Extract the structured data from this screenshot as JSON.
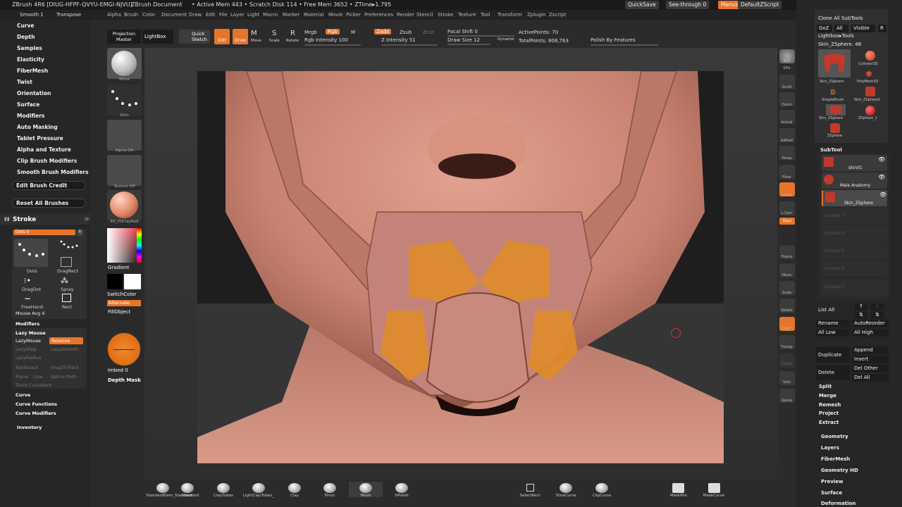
{
  "title_bar": {
    "app": "ZBrush 4R6 [DIUG-HFPF-QVYU-EMGI-NJVU]",
    "document": "ZBrush Document",
    "stats": "• Active Mem 443 • Scratch Disk 114 • Free Mem 3652 • ZTime▸1.795",
    "quicksave": "QuickSave",
    "see_through": "See-through 0",
    "menus": "Menus",
    "default_zscript": "DefaultZScript"
  },
  "top_left_tabs": [
    "Smooth 1",
    "Transpose"
  ],
  "menu_items": [
    "Alpha",
    "Brush",
    "Color",
    "Document",
    "Draw",
    "Edit",
    "File",
    "Layer",
    "Light",
    "Macro",
    "Marker",
    "Material",
    "Movie",
    "Picker",
    "Preferences",
    "Render",
    "Stencil",
    "Stroke",
    "Texture",
    "Tool",
    "Transform",
    "Zplugin",
    "Zscript"
  ],
  "left_palette": {
    "brush_sections": [
      "Curve",
      "Depth",
      "Samples",
      "Elasticity",
      "FiberMesh",
      "Twist",
      "Orientation",
      "Surface",
      "Modifiers",
      "Auto Masking",
      "Tablet Pressure",
      "Alpha and Texture",
      "Clip Brush Modifiers",
      "Smooth Brush Modifiers"
    ],
    "edit_brush_credit": "Edit Brush Credit",
    "reset_all_brushes": "Reset All Brushes",
    "stroke_title": "Stroke",
    "stroke_current": "Dots 0",
    "stroke_types": [
      "Dots",
      "DragRect",
      "DragDot",
      "Spray",
      "FreeHand",
      "Rect"
    ],
    "mouse_avg": "Mouse Avg 4",
    "modifiers": "Modifiers",
    "lazy_mouse": "Lazy Mouse",
    "lazymouse_label": "LazyMouse",
    "relative": "Relative",
    "disabled_options": [
      "LazyStep",
      "LazySmooth",
      "LazyRadius",
      "Backtrack",
      "SnapToTrack",
      "Plane",
      "Line",
      "Spline Path",
      "Track Curvature"
    ],
    "curve": "Curve",
    "curve_functions": "Curve Functions",
    "curve_modifiers": "Curve Modifiers",
    "inventory": "Inventory"
  },
  "tool_shelf": {
    "projection_master": "Projection Master",
    "lightbox": "LightBox",
    "quick_sketch": "Quick Sketch",
    "thumbs": [
      "Move",
      "Dots",
      "Alpha Off",
      "Texture Off",
      "RS_OilClayRed"
    ],
    "gradient": "Gradient",
    "switch_color": "SwitchColor",
    "alternate": "Alternate",
    "fill_object": "FillObject",
    "imbed": "Imbed 0",
    "depth_mask": "Depth Mask"
  },
  "toolbar": {
    "edit": "Edit",
    "draw": "Draw",
    "move": "Move",
    "scale": "Scale",
    "rotate": "Rotate",
    "mrgb": "Mrgb",
    "rgb": "Rgb",
    "m": "M",
    "rgb_intensity": "Rgb Intensity 100",
    "zadd": "Zadd",
    "zsub": "Zsub",
    "zcut": "Zcut",
    "z_intensity": "Z Intensity 51",
    "focal_shift": "Focal Shift 0",
    "draw_size": "Draw Size 12",
    "dynamic": "Dynamic",
    "active_points": "ActivePoints: 70",
    "total_points": "TotalPoints: 808,763",
    "polish": "Polish By Features"
  },
  "right_icons": [
    "BPR",
    "SPix",
    "Scroll",
    "Zoom",
    "Actual",
    "AAHalf",
    "Persp",
    "Floor",
    "Local",
    "L.Sym",
    "Gxyz",
    "Frame",
    "Move",
    "Scale",
    "Rotate",
    "PolyF",
    "Transp",
    "Ghost",
    "Solo",
    "Xpose"
  ],
  "right_palette": {
    "top_rows": [
      "Clone All SubTools",
      "GoZ",
      "All",
      "Visible",
      "Lightbox▸Tools",
      "Skin_ZSphere. 48",
      "R"
    ],
    "tools": [
      "Skin_ZSphere",
      "Cylinder3D",
      "PolyMesh3D",
      "SimpleBrush",
      "Skin_ZSphere1",
      "Skin_ZSphere",
      "ZSphere_1",
      "ZSphere"
    ],
    "subtool_title": "SubTool",
    "subtools": [
      "skin01",
      "Male Anatomy",
      "Skin_ZSphere"
    ],
    "empty_slots": [
      "Unused 3",
      "Unused 4",
      "Unused 5",
      "Unused 6",
      "Unused 7"
    ],
    "list_all": "List All",
    "rename": "Rename",
    "auto_reorder": "AutoReorder",
    "all_low": "All Low",
    "all_high": "All High",
    "duplicate": "Duplicate",
    "append": "Append",
    "insert": "Insert",
    "delete": "Delete",
    "del_other": "Del Other",
    "del_all": "Del All",
    "actions": [
      "Split",
      "Merge",
      "Remesh",
      "Project",
      "Extract"
    ],
    "sections": [
      "Geometry",
      "Layers",
      "FiberMesh",
      "Geometry HD",
      "Preview",
      "Surface",
      "Deformation"
    ]
  },
  "bottom_shelf": [
    "StandardDam_Standard",
    "Standard",
    "ClayTubes",
    "LightClayTubes_",
    "Clay",
    "Pinch",
    "Move",
    "hPolish",
    "SelectRect",
    "SliceCurve",
    "ClipCurve",
    "MaskPen",
    "MaskCurve"
  ],
  "colors": {
    "accent": "#e8742a",
    "panel": "#262626",
    "skin": "#c98b7c"
  }
}
